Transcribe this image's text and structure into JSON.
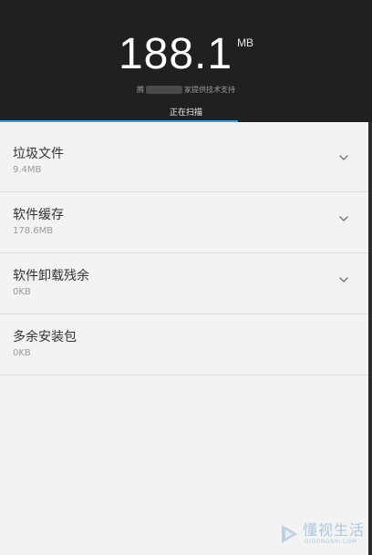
{
  "header": {
    "size_value": "188.1",
    "size_unit": "MB",
    "support_prefix": "腾",
    "support_suffix": "家提供技术支持",
    "scan_status": "正在扫描",
    "scan_progress": 0.64,
    "background_color": "#202020",
    "progress_color": "#2aa4f4"
  },
  "items": [
    {
      "title": "垃圾文件",
      "size": "9.4MB",
      "icon": "chevron-down-icon"
    },
    {
      "title": "软件缓存",
      "size": "178.6MB",
      "icon": "chevron-down-icon"
    },
    {
      "title": "软件卸载残余",
      "size": "0KB",
      "icon": "chevron-down-icon"
    },
    {
      "title": "多余安装包",
      "size": "0KB"
    }
  ],
  "watermark": {
    "text": "懂视生活",
    "sub": "DIDONGSHI.COM",
    "color": "#8fb5d6"
  }
}
